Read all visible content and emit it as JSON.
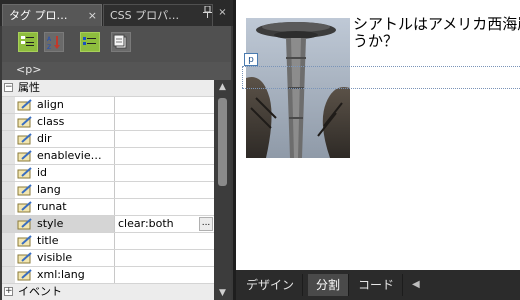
{
  "tabs": [
    {
      "label": "タグ プロ…",
      "active": true
    },
    {
      "label": "CSS プロパ…",
      "active": false
    }
  ],
  "panel_buttons": {
    "pin": "📌",
    "close": "×"
  },
  "tab_close_glyph": "×",
  "toolbar": {
    "buttons": [
      {
        "name": "categorized-view-icon",
        "pressed": true
      },
      {
        "name": "sort-alphabetical-icon",
        "pressed": false
      },
      {
        "name": "show-set-properties-icon",
        "pressed": true
      },
      {
        "name": "property-pages-icon",
        "pressed": false
      }
    ]
  },
  "tag_indicator": "<p>",
  "properties": {
    "category_expanded": "属性",
    "category_collapsed": "イベント",
    "expander_expanded": "−",
    "expander_collapsed": "+",
    "rows": [
      {
        "name": "align",
        "value": ""
      },
      {
        "name": "class",
        "value": ""
      },
      {
        "name": "dir",
        "value": ""
      },
      {
        "name": "enablevie…",
        "value": ""
      },
      {
        "name": "id",
        "value": ""
      },
      {
        "name": "lang",
        "value": ""
      },
      {
        "name": "runat",
        "value": ""
      },
      {
        "name": "style",
        "value": "clear:both",
        "selected": true
      },
      {
        "name": "title",
        "value": ""
      },
      {
        "name": "visible",
        "value": ""
      },
      {
        "name": "xml:lang",
        "value": ""
      }
    ],
    "ellipsis": "..."
  },
  "scrollbar": {
    "up": "▲",
    "down": "▼"
  },
  "document": {
    "line1": "シアトルはアメリカ西海岸",
    "line2": "うか？",
    "tag_marker": "p"
  },
  "view_tabs": [
    {
      "label": "デザイン",
      "active": false
    },
    {
      "label": "分割",
      "active": true
    },
    {
      "label": "コード",
      "active": false
    }
  ],
  "view_scroll_left": "◀"
}
